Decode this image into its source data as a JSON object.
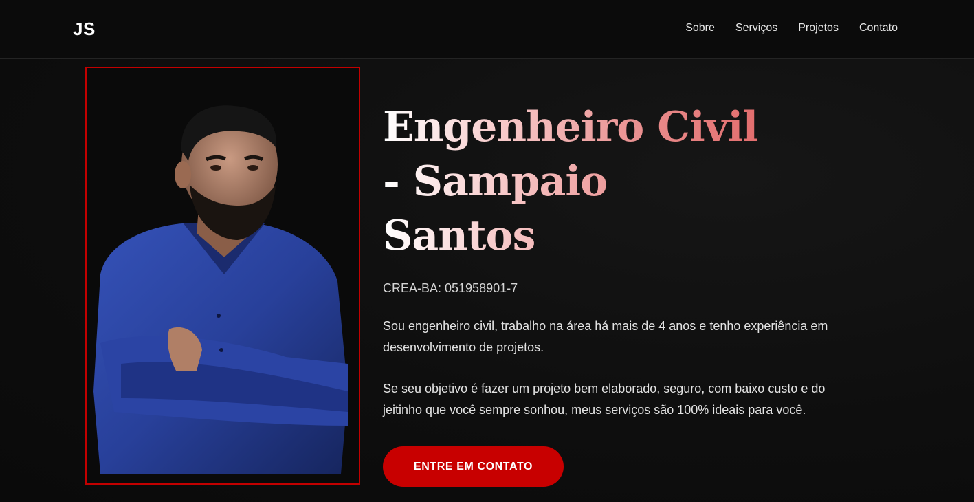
{
  "header": {
    "logo": "JS",
    "nav": [
      {
        "label": "Sobre"
      },
      {
        "label": "Serviços"
      },
      {
        "label": "Projetos"
      },
      {
        "label": "Contato"
      }
    ]
  },
  "hero": {
    "title": "Engenheiro Civil - Sampaio Santos",
    "crea": "CREA-BA: 051958901-7",
    "paragraph_1": "Sou engenheiro civil, trabalho na área há mais de 4 anos e tenho experiência em desenvolvimento de projetos.",
    "paragraph_2": "Se seu objetivo é fazer um projeto bem elaborado, seguro, com baixo custo e do jeitinho que você sempre sonhou, meus serviços são 100% ideais para você.",
    "cta_label": "ENTRE EM CONTATO"
  },
  "colors": {
    "accent": "#c80000",
    "background": "#0d0d0d",
    "title_gradient_end": "#e26b6b"
  }
}
